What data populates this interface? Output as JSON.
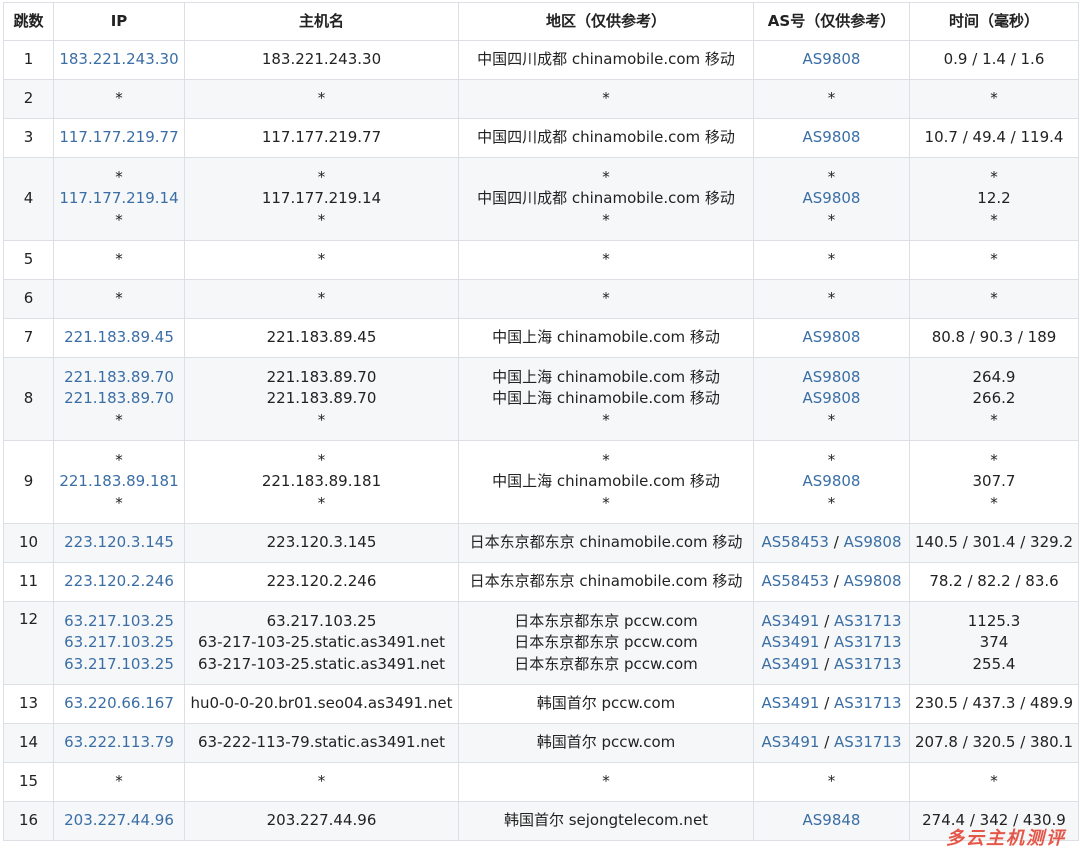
{
  "headers": [
    "跳数",
    "IP",
    "主机名",
    "地区（仅供参考）",
    "AS号（仅供参考）",
    "时间（毫秒）"
  ],
  "rows": [
    {
      "hop": "1",
      "lines": [
        {
          "ip": "183.221.243.30",
          "host": "183.221.243.30",
          "region": "中国四川成都 chinamobile.com 移动",
          "as": [
            "AS9808"
          ]
        }
      ],
      "time": [
        "0.9 / 1.4 / 1.6"
      ]
    },
    {
      "hop": "2",
      "lines": [
        {
          "ip": "*",
          "host": "*",
          "region": "*",
          "as": [
            "*"
          ]
        }
      ],
      "time": [
        "*"
      ]
    },
    {
      "hop": "3",
      "lines": [
        {
          "ip": "117.177.219.77",
          "host": "117.177.219.77",
          "region": "中国四川成都 chinamobile.com 移动",
          "as": [
            "AS9808"
          ]
        }
      ],
      "time": [
        "10.7 / 49.4 / 119.4"
      ]
    },
    {
      "hop": "4",
      "lines": [
        {
          "ip": "*",
          "host": "*",
          "region": "*",
          "as": [
            "*"
          ]
        },
        {
          "ip": "117.177.219.14",
          "host": "117.177.219.14",
          "region": "中国四川成都 chinamobile.com 移动",
          "as": [
            "AS9808"
          ]
        },
        {
          "ip": "*",
          "host": "*",
          "region": "*",
          "as": [
            "*"
          ]
        }
      ],
      "time": [
        "*",
        "12.2",
        "*"
      ]
    },
    {
      "hop": "5",
      "lines": [
        {
          "ip": "*",
          "host": "*",
          "region": "*",
          "as": [
            "*"
          ]
        }
      ],
      "time": [
        "*"
      ]
    },
    {
      "hop": "6",
      "lines": [
        {
          "ip": "*",
          "host": "*",
          "region": "*",
          "as": [
            "*"
          ]
        }
      ],
      "time": [
        "*"
      ]
    },
    {
      "hop": "7",
      "lines": [
        {
          "ip": "221.183.89.45",
          "host": "221.183.89.45",
          "region": "中国上海 chinamobile.com 移动",
          "as": [
            "AS9808"
          ]
        }
      ],
      "time": [
        "80.8 / 90.3 / 189"
      ]
    },
    {
      "hop": "8",
      "lines": [
        {
          "ip": "221.183.89.70",
          "host": "221.183.89.70",
          "region": "中国上海 chinamobile.com 移动",
          "as": [
            "AS9808"
          ]
        },
        {
          "ip": "221.183.89.70",
          "host": "221.183.89.70",
          "region": "中国上海 chinamobile.com 移动",
          "as": [
            "AS9808"
          ]
        },
        {
          "ip": "*",
          "host": "*",
          "region": "*",
          "as": [
            "*"
          ]
        }
      ],
      "time": [
        "264.9",
        "266.2",
        "*"
      ]
    },
    {
      "hop": "9",
      "lines": [
        {
          "ip": "*",
          "host": "*",
          "region": "*",
          "as": [
            "*"
          ]
        },
        {
          "ip": "221.183.89.181",
          "host": "221.183.89.181",
          "region": "中国上海 chinamobile.com 移动",
          "as": [
            "AS9808"
          ]
        },
        {
          "ip": "*",
          "host": "*",
          "region": "*",
          "as": [
            "*"
          ]
        }
      ],
      "time": [
        "*",
        "307.7",
        "*"
      ]
    },
    {
      "hop": "10",
      "lines": [
        {
          "ip": "223.120.3.145",
          "host": "223.120.3.145",
          "region": "日本东京都东京 chinamobile.com 移动",
          "as": [
            "AS58453",
            "AS9808"
          ]
        }
      ],
      "time": [
        "140.5 / 301.4 / 329.2"
      ]
    },
    {
      "hop": "11",
      "lines": [
        {
          "ip": "223.120.2.246",
          "host": "223.120.2.246",
          "region": "日本东京都东京 chinamobile.com 移动",
          "as": [
            "AS58453",
            "AS9808"
          ]
        }
      ],
      "time": [
        "78.2 / 82.2 / 83.6"
      ]
    },
    {
      "hop": "12",
      "lines": [
        {
          "ip": "63.217.103.25",
          "host": "63.217.103.25",
          "region": "日本东京都东京 pccw.com",
          "as": [
            "AS3491",
            "AS31713"
          ]
        },
        {
          "ip": "63.217.103.25",
          "host": "63-217-103-25.static.as3491.net",
          "region": "日本东京都东京 pccw.com",
          "as": [
            "AS3491",
            "AS31713"
          ]
        },
        {
          "ip": "63.217.103.25",
          "host": "63-217-103-25.static.as3491.net",
          "region": "日本东京都东京 pccw.com",
          "as": [
            "AS3491",
            "AS31713"
          ]
        }
      ],
      "time": [
        "1125.3",
        "374",
        "255.4"
      ]
    },
    {
      "hop": "13",
      "lines": [
        {
          "ip": "63.220.66.167",
          "host": "hu0-0-0-20.br01.seo04.as3491.net",
          "region": "韩国首尔 pccw.com",
          "as": [
            "AS3491",
            "AS31713"
          ]
        }
      ],
      "time": [
        "230.5 / 437.3 / 489.9"
      ]
    },
    {
      "hop": "14",
      "lines": [
        {
          "ip": "63.222.113.79",
          "host": "63-222-113-79.static.as3491.net",
          "region": "韩国首尔 pccw.com",
          "as": [
            "AS3491",
            "AS31713"
          ]
        }
      ],
      "time": [
        "207.8 / 320.5 / 380.1"
      ]
    },
    {
      "hop": "15",
      "lines": [
        {
          "ip": "*",
          "host": "*",
          "region": "*",
          "as": [
            "*"
          ]
        }
      ],
      "time": [
        "*"
      ]
    },
    {
      "hop": "16",
      "lines": [
        {
          "ip": "203.227.44.96",
          "host": "203.227.44.96",
          "region": "韩国首尔 sejongtelecom.net",
          "as": [
            "AS9848"
          ]
        }
      ],
      "time": [
        "274.4 / 342 / 430.9"
      ]
    }
  ],
  "as_separator": " / ",
  "watermark": "多云主机测评",
  "colors": {
    "link": "#3a6ea5",
    "border": "#dcdfe3",
    "row_alt": "#f6f7f8",
    "watermark": "#e23a2a"
  }
}
